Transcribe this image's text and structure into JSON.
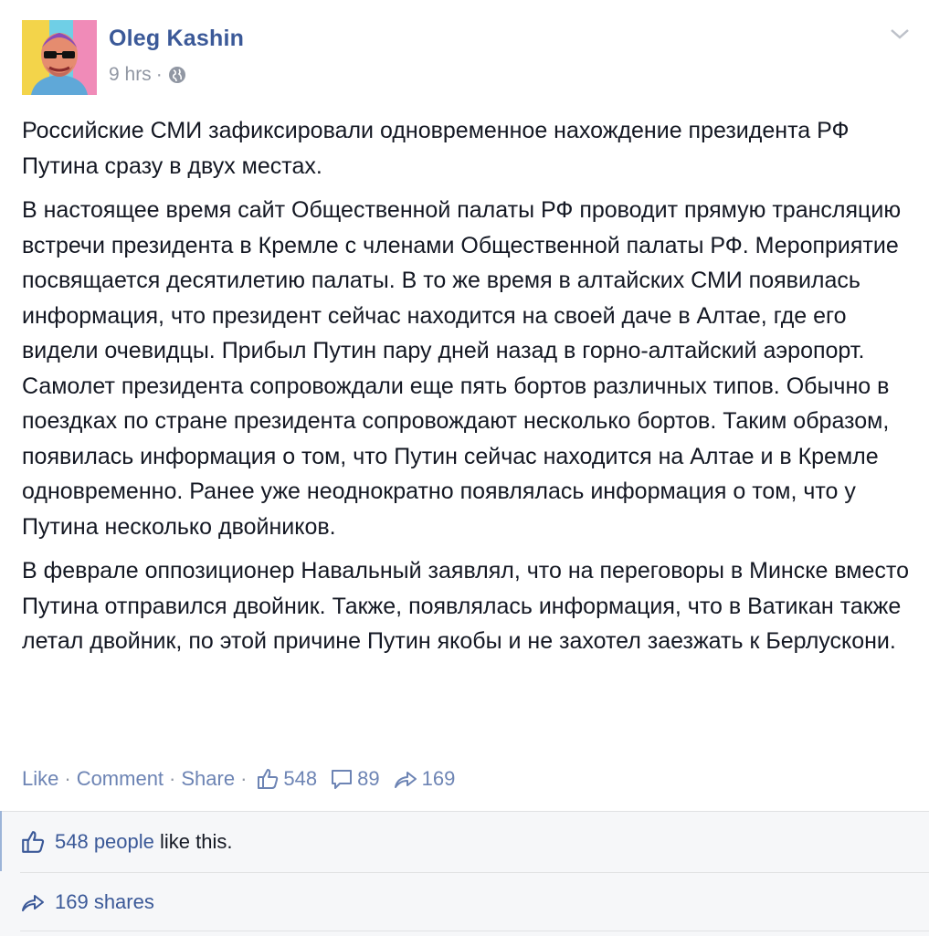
{
  "author": {
    "name": "Oleg Kashin"
  },
  "meta": {
    "time": "9 hrs",
    "separator": "·"
  },
  "post": {
    "paragraphs": [
      "Российские СМИ зафиксировали одновременное нахождение президента РФ Путина сразу в двух местах.",
      "В настоящее время сайт Общественной палаты РФ проводит прямую трансляцию встречи президента в Кремле с членами Общественной палаты РФ. Мероприятие посвящается десятилетию палаты. В то же время в алтайских СМИ появилась информация, что президент сейчас находится на своей даче в Алтае, где его видели очевидцы. Прибыл Путин пару дней назад в горно-алтайский аэропорт. Самолет президента сопровождали еще пять бортов различных типов. Обычно в поездках по стране президента сопровождают несколько бортов. Таким образом, появилась информация о том, что Путин сейчас находится на Алтае и в Кремле одновременно. Ранее уже неоднократно появлялась информация о том, что у Путина несколько двойников.",
      "В феврале оппозиционер Навальный заявлял, что на переговоры в Минске вместо Путина отправился двойник. Также, появлялась информация, что в Ватикан также летал двойник, по этой причине Путин якобы и не захотел заезжать к Берлускони."
    ]
  },
  "actions": {
    "like": "Like",
    "comment": "Comment",
    "share": "Share",
    "dot": "·",
    "like_count": "548",
    "comment_count": "89",
    "share_count": "169"
  },
  "ufi": {
    "likes_link": "548 people",
    "likes_suffix": " like this.",
    "shares_link": "169 shares"
  },
  "colors": {
    "link": "#3b5998",
    "muted": "#9197a3",
    "action": "#6d84b4"
  },
  "icons": {
    "globe": "globe-icon",
    "chevron": "chevron-down-icon",
    "thumb": "thumbs-up-icon",
    "comment": "comment-bubble-icon",
    "share": "share-arrow-icon"
  }
}
